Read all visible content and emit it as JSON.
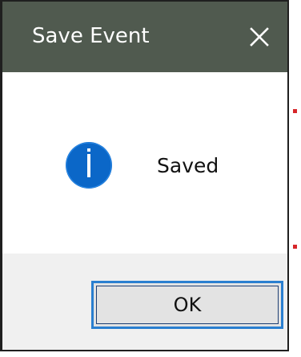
{
  "window": {
    "title": "Save Event",
    "close_icon": "close-icon"
  },
  "message": {
    "icon": "info-icon",
    "text": "Saved"
  },
  "actions": {
    "ok_label": "OK"
  },
  "colors": {
    "titlebar": "#505a4f",
    "info_blue": "#0b67c8",
    "focus_blue": "#2a7fd0",
    "footer": "#f0f0f0",
    "marker_red": "#d7262a"
  }
}
